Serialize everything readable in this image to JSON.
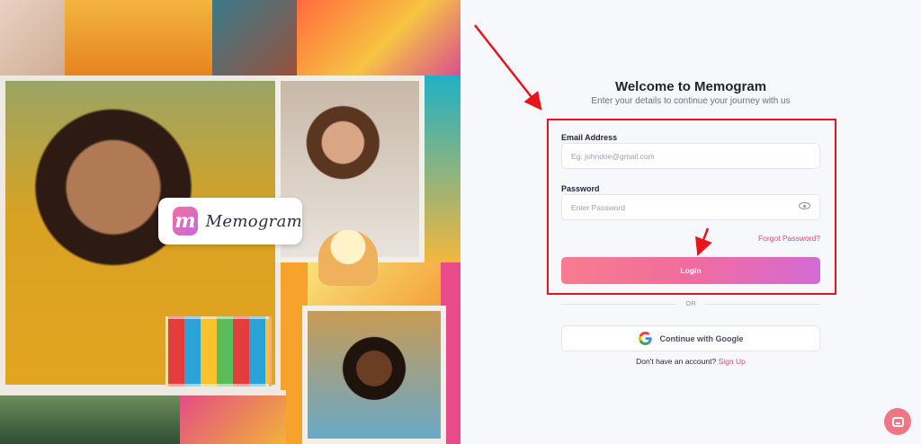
{
  "brand": {
    "logo_mark": "m",
    "logo_text": "Memogram"
  },
  "login": {
    "title": "Welcome to Memogram",
    "subtitle": "Enter your details to continue your journey with us",
    "email_label": "Email Address",
    "email_placeholder": "Eg: johndoe@gmail.com",
    "password_label": "Password",
    "password_placeholder": "Enter Password",
    "forgot_link": "Forgot Password?",
    "login_button": "Login",
    "divider_text": "OR",
    "google_button": "Continue with Google",
    "signup_prompt": "Don't have an account?",
    "signup_link": "Sign Up"
  },
  "icons": {
    "password_toggle": "eye-icon",
    "google": "google-logo-icon",
    "chat": "chat-bubble-icon"
  },
  "colors": {
    "accent": "#e7447f",
    "login_gradient_start": "#f87b8f",
    "login_gradient_end": "#d46ad4",
    "annotation_red": "#e8141b"
  }
}
